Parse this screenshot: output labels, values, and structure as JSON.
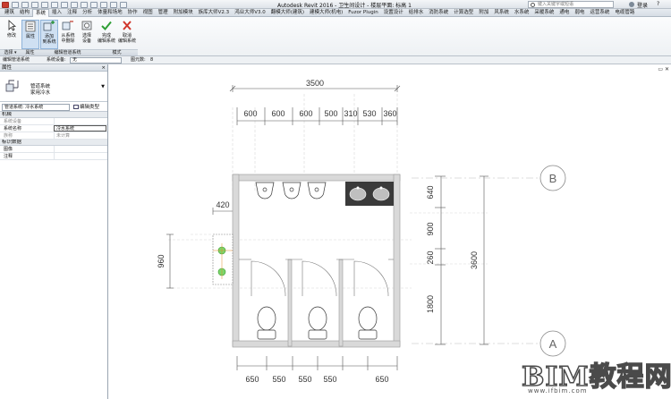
{
  "window": {
    "title": "Autodesk Revit 2016 -    卫生间设计 - 楼层平面: 标高 1",
    "search_placeholder": "键入关键字或短语",
    "login_label": "登录"
  },
  "tabs": [
    "建筑",
    "结构",
    "系统",
    "插入",
    "注释",
    "分析",
    "体量和场地",
    "协作",
    "视图",
    "管理",
    "附加模块",
    "族库大师V2.3",
    "鸿业大师V3.0",
    "翻模大师(建筑)",
    "建模大师(机电)",
    "Fuzor Plugin",
    "设置设计",
    "给排水",
    "消防系统",
    "计算选型",
    "附加",
    "风系统",
    "水系统",
    "采暖系统",
    "通电",
    "弱电",
    "运营系统",
    "电缆管路"
  ],
  "ribbon": {
    "buttons": [
      {
        "label1": "修改",
        "label2": ""
      },
      {
        "label1": "属性",
        "label2": ""
      },
      {
        "label1": "添加",
        "label2": "到系统"
      },
      {
        "label1": "从系统",
        "label2": "中删除"
      },
      {
        "label1": "选择",
        "label2": "设备"
      },
      {
        "label1": "完成",
        "label2": "编辑系统"
      },
      {
        "label1": "取消",
        "label2": "编辑系统"
      }
    ],
    "groups": [
      "选择 ▾",
      "属性",
      "编辑管道系统",
      "模式"
    ]
  },
  "options_bar": {
    "label": "编辑管道系统",
    "system_label": "系统设备:",
    "system_value": "无",
    "count_label": "图元数:",
    "count_value": "8"
  },
  "properties": {
    "title": "属性",
    "close": "×",
    "type_line1": "管道系统",
    "type_line2": "家用冷水",
    "filter_value": "管道系统: 冷水系统",
    "edit_type": "编辑类型",
    "group_mechanical": "机械",
    "rows_mech": [
      {
        "k": "系统设备",
        "v": "",
        "dim": true
      },
      {
        "k": "系统名称",
        "v": "冷水系统",
        "boxed": true
      },
      {
        "k": "族称",
        "v": "未计算",
        "dim": true
      }
    ],
    "group_identity": "标识数据",
    "rows_id": [
      {
        "k": "图像",
        "v": ""
      },
      {
        "k": "注释",
        "v": ""
      }
    ]
  },
  "drawing": {
    "dim_total_top": "3500",
    "dims_top": [
      "600",
      "600",
      "600",
      "500",
      "310",
      "530",
      "360"
    ],
    "dim_420": "420",
    "dim_960": "960",
    "dims_right": [
      "640",
      "900",
      "260",
      "1800"
    ],
    "dim_total_right": "3600",
    "dims_bottom": [
      "650",
      "550",
      "550",
      "550",
      "650"
    ],
    "grid_b": "B",
    "grid_a": "A"
  },
  "watermark": {
    "brand": "BIM教程网",
    "url": "www.ifbim.com"
  }
}
